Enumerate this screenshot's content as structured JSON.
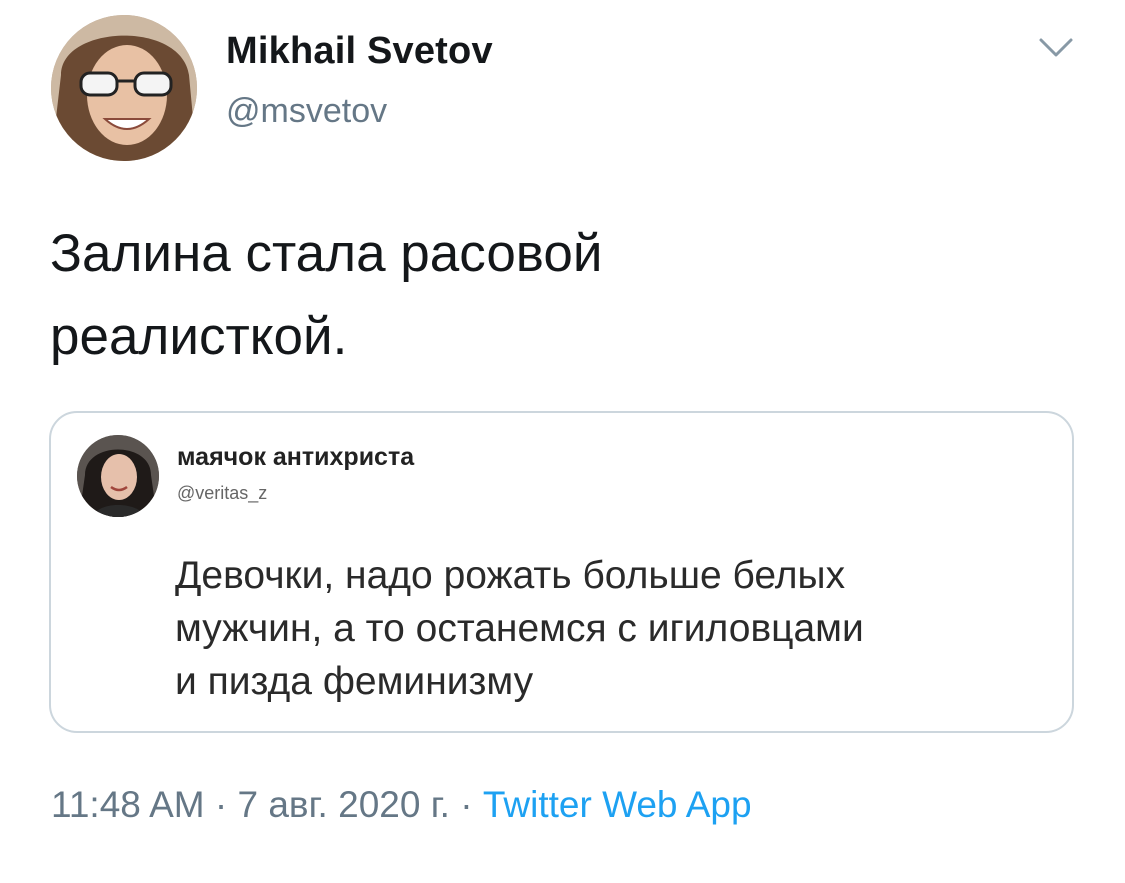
{
  "tweet": {
    "author": {
      "display_name": "Mikhail Svetov",
      "handle": "@msvetov",
      "avatar": "avatar-photo"
    },
    "menu_icon": "chevron-down-icon",
    "text_line1": "Залина стала расовой",
    "text_line2": "реалисткой.",
    "quoted": {
      "display_name": "маячок антихриста",
      "handle": "@veritas_z",
      "avatar": "avatar-photo",
      "text_line1": "Девочки, надо рожать больше белых",
      "text_line2": "мужчин, а то останемся с игиловцами",
      "text_line3": "и пизда феминизму"
    },
    "meta": {
      "time": "11:48 AM",
      "separator": " · ",
      "date": "7 авг. 2020 г.",
      "separator2": " · ",
      "source": "Twitter Web App"
    }
  },
  "colors": {
    "text": "#14171a",
    "secondary": "#657786",
    "link": "#1da1f2",
    "border": "#ccd6dd"
  }
}
